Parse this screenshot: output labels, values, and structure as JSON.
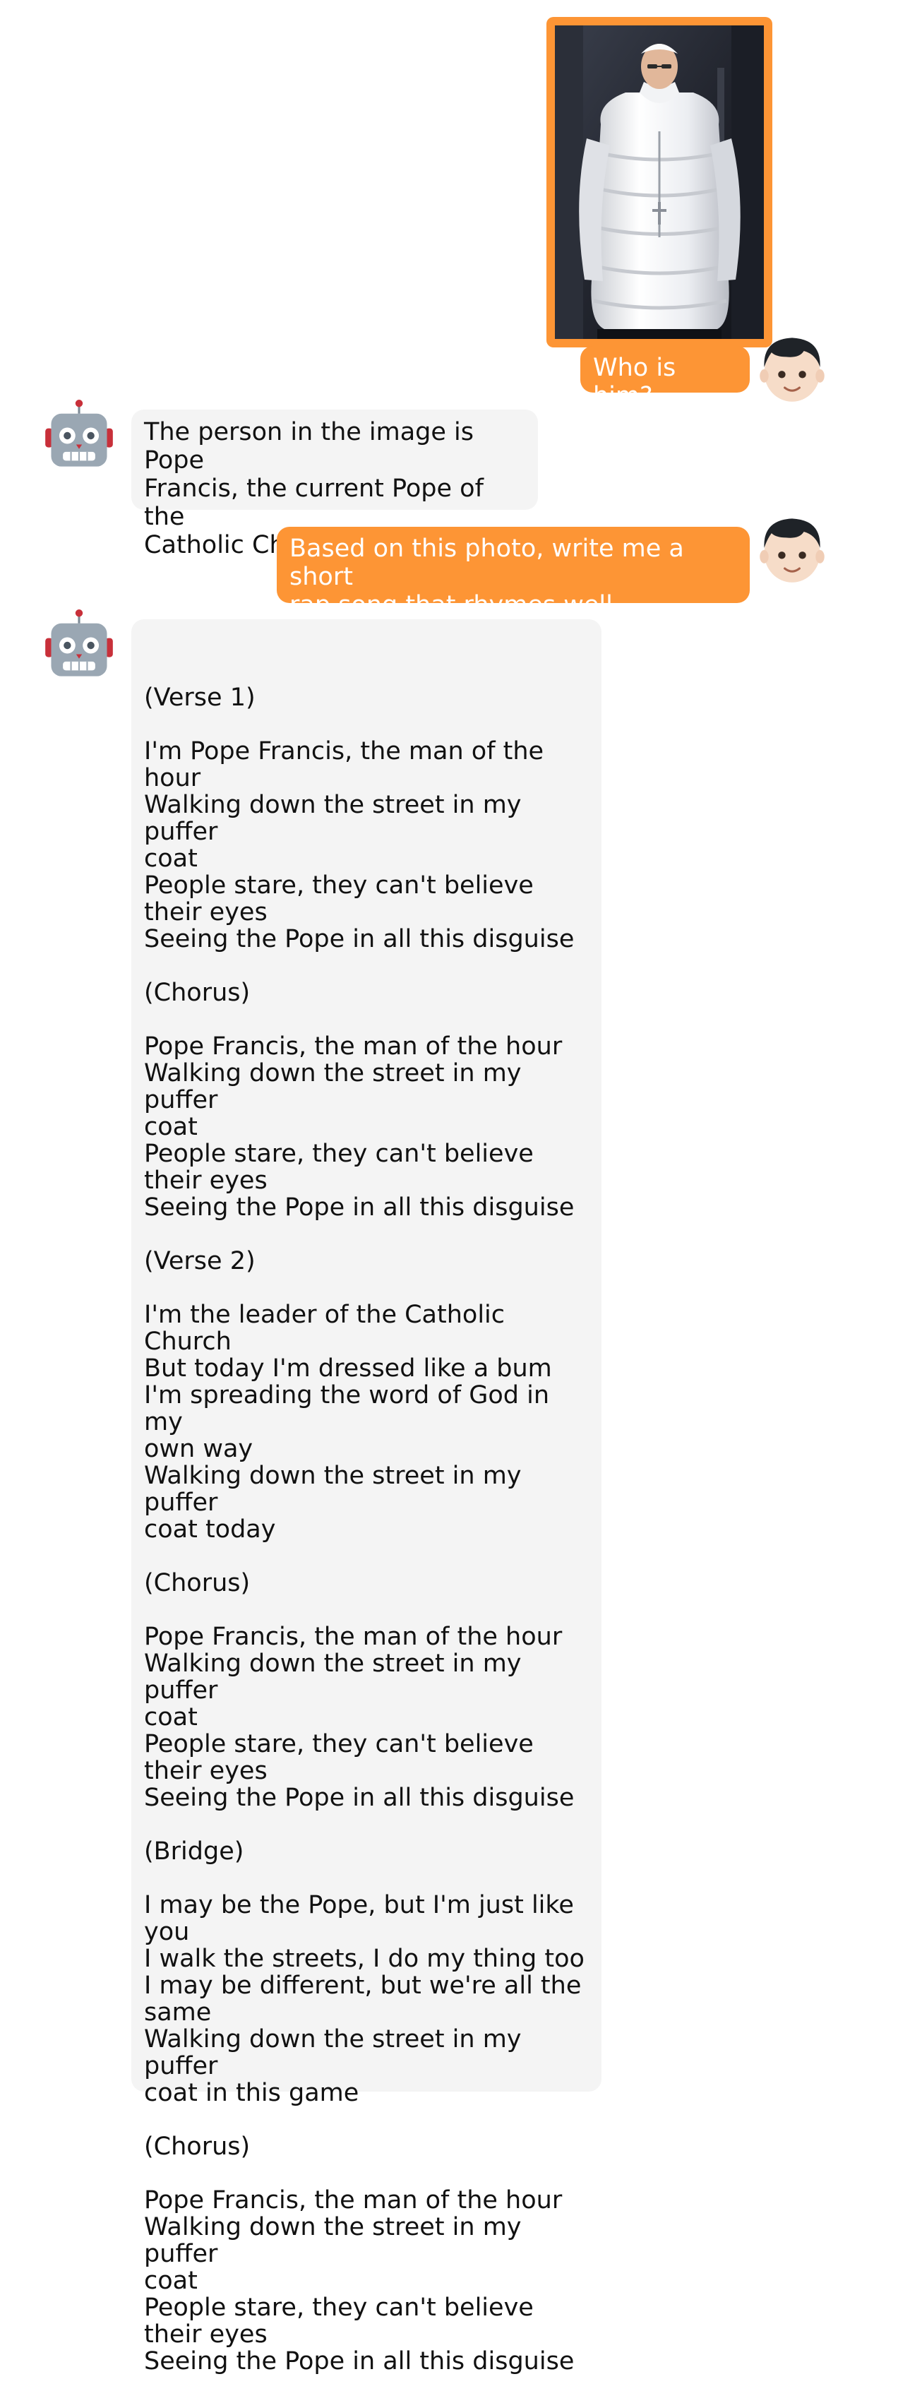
{
  "chat": {
    "messages": [
      {
        "role": "user",
        "type": "image",
        "image_icon": "photo-of-pope-in-white-puffer-coat-image"
      },
      {
        "role": "user",
        "text": "Who is him?",
        "avatar_icon": "boy-face-icon"
      },
      {
        "role": "assistant",
        "avatar_icon": "robot-face-icon",
        "lines": [
          "The person in the image is Pope",
          "Francis, the current Pope of the",
          "Catholic Church."
        ]
      },
      {
        "role": "user",
        "avatar_icon": "boy-face-icon",
        "lines": [
          "Based on this photo, write me a short",
          "rap song that rhymes well."
        ]
      },
      {
        "role": "assistant",
        "avatar_icon": "robot-face-icon",
        "text": "(Verse 1)\n\nI'm Pope Francis, the man of the hour\nWalking down the street in my puffer\ncoat\nPeople stare, they can't believe\ntheir eyes\nSeeing the Pope in all this disguise\n\n(Chorus)\n\nPope Francis, the man of the hour\nWalking down the street in my puffer\ncoat\nPeople stare, they can't believe\ntheir eyes\nSeeing the Pope in all this disguise\n\n(Verse 2)\n\nI'm the leader of the Catholic Church\nBut today I'm dressed like a bum\nI'm spreading the word of God in my\nown way\nWalking down the street in my puffer\ncoat today\n\n(Chorus)\n\nPope Francis, the man of the hour\nWalking down the street in my puffer\ncoat\nPeople stare, they can't believe\ntheir eyes\nSeeing the Pope in all this disguise\n\n(Bridge)\n\nI may be the Pope, but I'm just like\nyou\nI walk the streets, I do my thing too\nI may be different, but we're all the\nsame\nWalking down the street in my puffer\ncoat in this game\n\n(Chorus)\n\nPope Francis, the man of the hour\nWalking down the street in my puffer\ncoat\nPeople stare, they can't believe\ntheir eyes\nSeeing the Pope in all this disguise"
      }
    ]
  },
  "colors": {
    "user_bubble": "#fd9535",
    "bot_bubble": "#f4f4f4",
    "text": "#111111",
    "user_text": "#ffffff"
  }
}
